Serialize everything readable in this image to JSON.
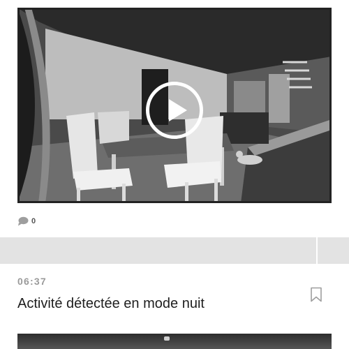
{
  "feed": {
    "items": [
      {
        "type": "video",
        "thumbnail": "night-vision-camera-still",
        "play_icon": "play-icon",
        "comment_icon": "comment-bubble-icon",
        "comment_count": "0"
      }
    ],
    "event": {
      "time": "06:37",
      "title": "Activité détectée en mode nuit",
      "bookmark_icon": "bookmark-icon"
    },
    "next_item": {
      "type": "video",
      "thumbnail": "night-vision-camera-still"
    }
  },
  "colors": {
    "band": "#e3e3e3",
    "time_text": "#9a9a9a",
    "title_text": "#1e1e1e",
    "icon_grey": "#9e9e9e"
  }
}
